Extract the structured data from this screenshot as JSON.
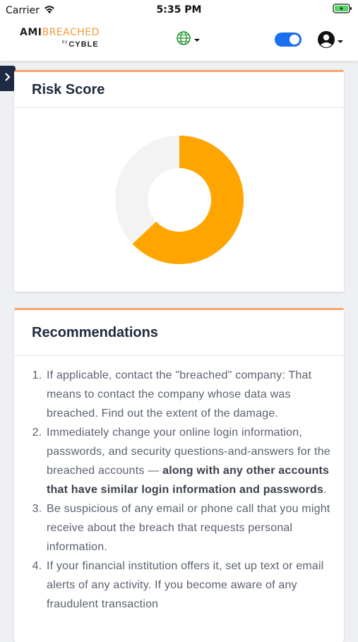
{
  "status_bar": {
    "carrier": "Carrier",
    "time": "5:35 PM"
  },
  "header": {
    "logo_ami": "AMI",
    "logo_breached": "BREACHED",
    "logo_by": "by",
    "logo_brand": "CYBLE",
    "colors": {
      "accent": "#f29a3a",
      "toggle": "#1a6ef0"
    }
  },
  "risk_card": {
    "title": "Risk Score",
    "donut": {
      "value_fraction": 0.63,
      "filled_color": "#ffa500",
      "empty_color": "#f3f3f3"
    }
  },
  "recommendations": {
    "title": "Recommendations",
    "items": [
      {
        "text": "If applicable, contact the \"breached\" company: That means to contact the company whose data was breached. Find out the extent of the damage."
      },
      {
        "text": "Immediately change your online login information, passwords, and security questions-and-answers for the breached accounts — ",
        "bold": "along with any other accounts that have similar login information and passwords",
        "tail": "."
      },
      {
        "text": "Be suspicious of any email or phone call that you might receive about the breach that requests personal information."
      },
      {
        "text": "If your financial institution offers it, set up text or email alerts of any activity. If you become aware of any fraudulent transaction"
      }
    ]
  }
}
